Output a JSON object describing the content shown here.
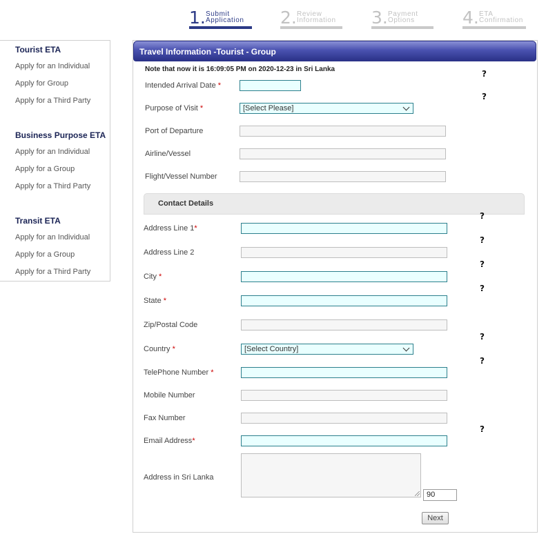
{
  "steps": [
    {
      "num": "1.",
      "line1": "Submit",
      "line2": "Application",
      "state": "active"
    },
    {
      "num": "2.",
      "line1": "Review",
      "line2": "Information",
      "state": "inactive"
    },
    {
      "num": "3.",
      "line1": "Payment",
      "line2": "Options",
      "state": "inactive"
    },
    {
      "num": "4.",
      "line1": "ETA",
      "line2": "Confirmation",
      "state": "inactive"
    }
  ],
  "sidebar": {
    "groups": [
      {
        "title": "Tourist ETA",
        "links": [
          "Apply for an Individual",
          "Apply for Group",
          "Apply for a Third Party"
        ]
      },
      {
        "title": "Business Purpose ETA",
        "links": [
          "Apply for an Individual",
          "Apply for a Group",
          "Apply for a Third Party"
        ]
      },
      {
        "title": "Transit ETA",
        "links": [
          "Apply for an Individual",
          "Apply for a Group",
          "Apply for a Third Party"
        ]
      }
    ]
  },
  "panel": {
    "title": "Travel Information -Tourist - Group",
    "note": "Note that now it is 16:09:05 PM on 2020-12-23 in Sri Lanka",
    "fields": {
      "arrival_date": {
        "label": "Intended Arrival Date",
        "value": ""
      },
      "purpose": {
        "label": "Purpose of Visit",
        "value": "[Select Please]"
      },
      "port": {
        "label": "Port of Departure",
        "value": ""
      },
      "airline": {
        "label": "Airline/Vessel",
        "value": ""
      },
      "flight": {
        "label": "Flight/Vessel Number",
        "value": ""
      }
    },
    "contact_section": "Contact Details",
    "contact": {
      "address1": {
        "label": "Address Line 1",
        "value": ""
      },
      "address2": {
        "label": "Address Line 2",
        "value": ""
      },
      "city": {
        "label": "City",
        "value": ""
      },
      "state": {
        "label": "State",
        "value": ""
      },
      "zip": {
        "label": "Zip/Postal Code",
        "value": ""
      },
      "country": {
        "label": "Country",
        "value": "[Select Country]"
      },
      "telephone": {
        "label": "TelePhone Number",
        "value": ""
      },
      "mobile": {
        "label": "Mobile Number",
        "value": ""
      },
      "fax": {
        "label": "Fax Number",
        "value": ""
      },
      "email": {
        "label": "Email Address",
        "value": ""
      },
      "sl_address": {
        "label": "Address in Sri Lanka",
        "value": ""
      }
    },
    "char_counter": "90",
    "required_mark": "*",
    "help_mark": "?",
    "next_label": "Next"
  }
}
